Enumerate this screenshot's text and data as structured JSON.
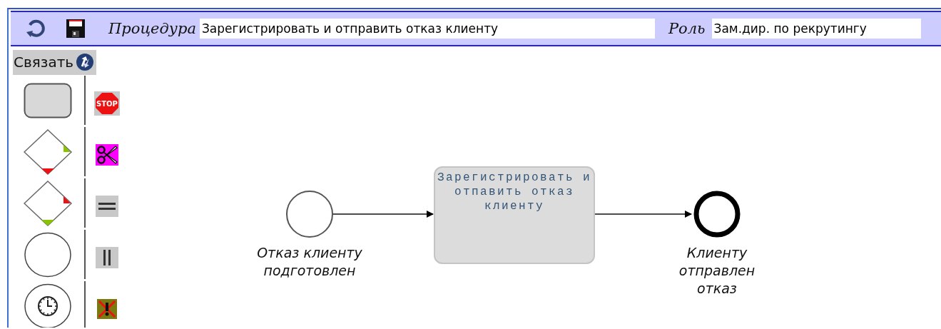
{
  "toolbar": {
    "procedure_label": "Процедура",
    "procedure_value": "Зарегистрировать и отправить отказ клиенту",
    "role_label": "Роль",
    "role_value": "Зам.дир. по рекрутингу"
  },
  "connect_button": {
    "label": "Связать"
  },
  "palette": [
    {
      "kind": "task",
      "marker": {
        "kind": "stop",
        "text": "STOP"
      }
    },
    {
      "kind": "gateway_out",
      "marker": {
        "kind": "scissors"
      }
    },
    {
      "kind": "gateway_in",
      "marker": {
        "kind": "parallel_horizontal"
      }
    },
    {
      "kind": "event",
      "marker": {
        "kind": "parallel_vertical"
      }
    },
    {
      "kind": "timer_event",
      "marker": {
        "kind": "cancel"
      }
    }
  ],
  "diagram": {
    "nodes": [
      {
        "kind": "start_event",
        "label": "Отказ клиенту подготовлен"
      },
      {
        "kind": "task",
        "label": "Зарегистрировать и отпавить отказ клиенту"
      },
      {
        "kind": "end_event",
        "label": "Клиенту отправлен отказ"
      }
    ]
  }
}
